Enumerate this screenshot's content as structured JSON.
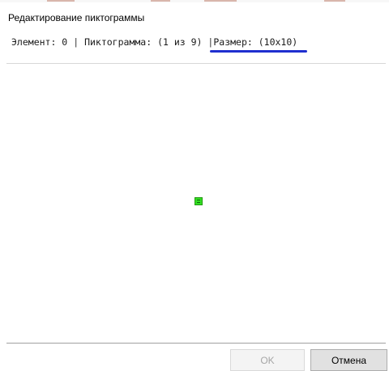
{
  "dialog": {
    "title": "Редактирование пиктограммы"
  },
  "info": {
    "element": "Элемент: 0",
    "separator": "|",
    "icon": "Пиктограмма: (1 из 9)",
    "size": "Размер: (10x10)"
  },
  "canvas": {
    "icon_color": "#33dd22"
  },
  "buttons": {
    "ok_label": "OK",
    "ok_enabled": false,
    "cancel_label": "Отмена"
  }
}
